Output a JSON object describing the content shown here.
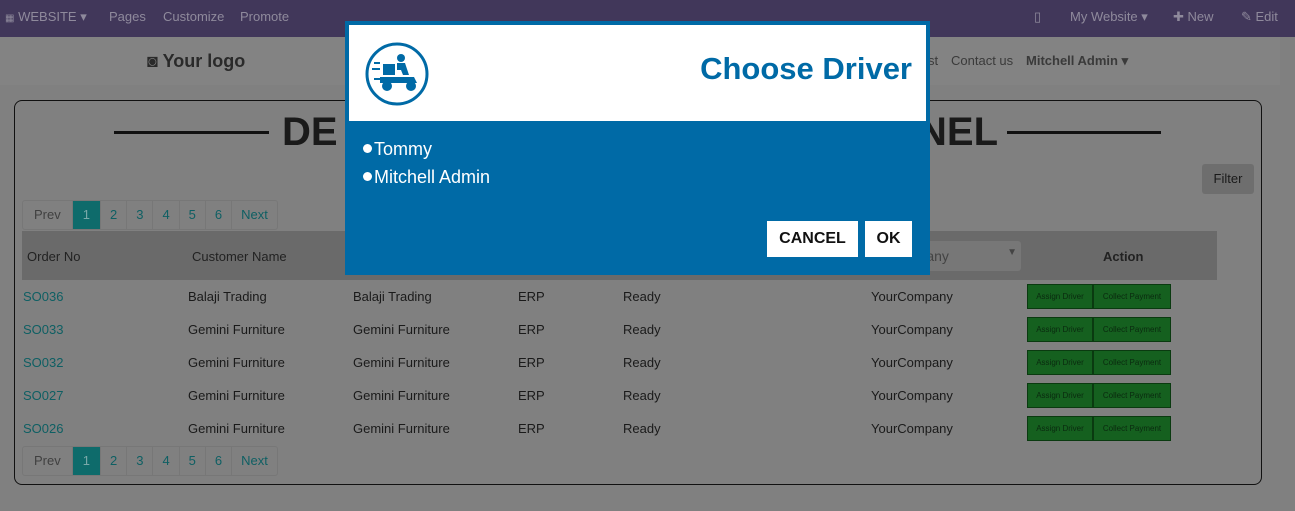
{
  "navbar": {
    "website": "WEBSITE",
    "pages": "Pages",
    "customize": "Customize",
    "promote": "Promote",
    "my_website": "My Website",
    "new": "New",
    "edit": "Edit"
  },
  "header": {
    "logo": "Your logo",
    "partial_menu": "st",
    "contact": "Contact us",
    "user": "Mitchell Admin"
  },
  "panel": {
    "title_left": "DE",
    "title_right": "NEL",
    "filter": "Filter"
  },
  "pagination": {
    "prev": "Prev",
    "pages": [
      "1",
      "2",
      "3",
      "4",
      "5",
      "6"
    ],
    "next": "Next",
    "active": "1"
  },
  "table": {
    "headers": {
      "order": "Order No",
      "customer": "Customer Name",
      "action": "Action"
    },
    "company_select": "Company",
    "rows": [
      {
        "order": "SO036",
        "customer": "Balaji Trading",
        "c3": "Balaji Trading",
        "c4": "ERP",
        "status": "Ready",
        "company": "YourCompany"
      },
      {
        "order": "SO033",
        "customer": "Gemini Furniture",
        "c3": "Gemini Furniture",
        "c4": "ERP",
        "status": "Ready",
        "company": "YourCompany"
      },
      {
        "order": "SO032",
        "customer": "Gemini Furniture",
        "c3": "Gemini Furniture",
        "c4": "ERP",
        "status": "Ready",
        "company": "YourCompany"
      },
      {
        "order": "SO027",
        "customer": "Gemini Furniture",
        "c3": "Gemini Furniture",
        "c4": "ERP",
        "status": "Ready",
        "company": "YourCompany"
      },
      {
        "order": "SO026",
        "customer": "Gemini Furniture",
        "c3": "Gemini Furniture",
        "c4": "ERP",
        "status": "Ready",
        "company": "YourCompany"
      }
    ],
    "assign": "Assign Driver",
    "collect": "Collect Payment"
  },
  "modal": {
    "title": "Choose Driver",
    "icon": "delivery-scooter-icon",
    "options": [
      "Tommy",
      "Mitchell Admin"
    ],
    "cancel": "CANCEL",
    "ok": "OK",
    "color": "#006aa6"
  }
}
